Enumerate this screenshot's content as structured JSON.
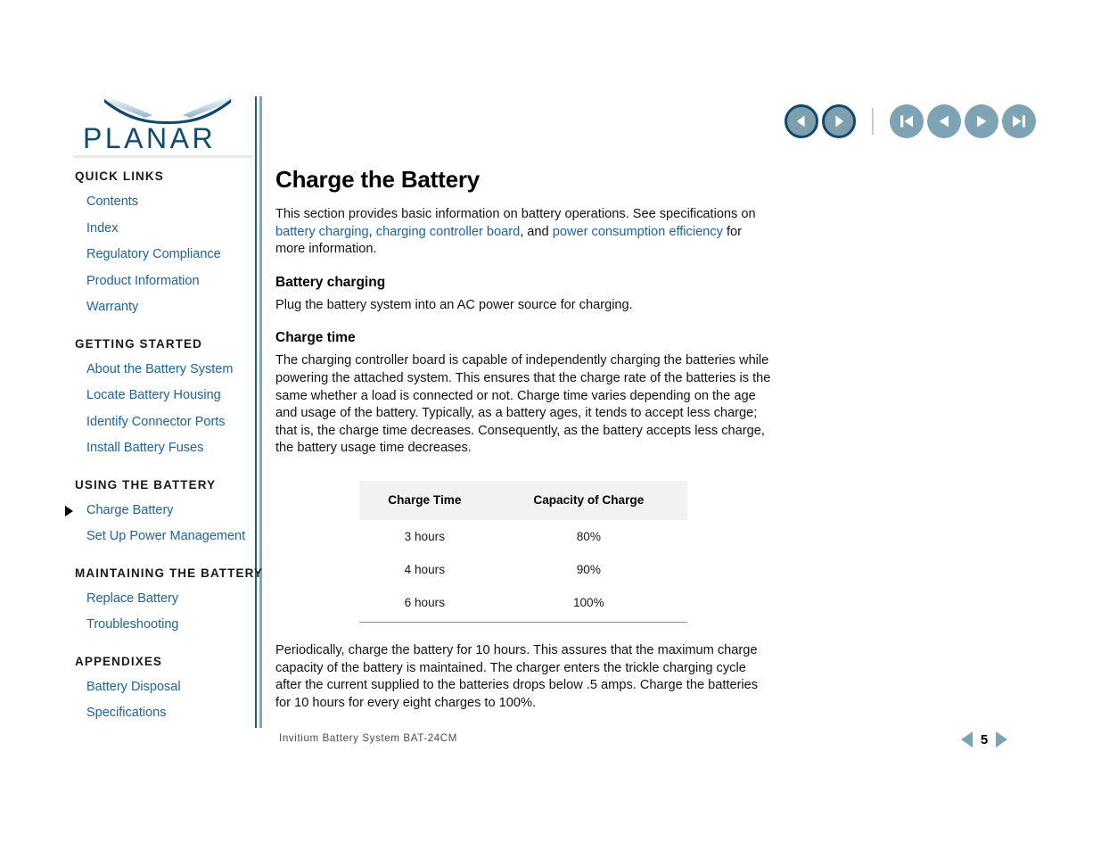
{
  "brand": {
    "name": "PLANAR",
    "logo_color": "#114a6b"
  },
  "topnav": {
    "back_label": "Back",
    "forward_label": "Forward",
    "first_label": "First Page",
    "prev_label": "Previous Page",
    "next_label": "Next Page",
    "last_label": "Last Page"
  },
  "sidebar": {
    "sections": [
      {
        "heading": "QUICK LINKS",
        "items": [
          {
            "label": "Contents",
            "active": false
          },
          {
            "label": "Index",
            "active": false
          },
          {
            "label": "Regulatory Compliance",
            "active": false
          },
          {
            "label": "Product Information",
            "active": false
          },
          {
            "label": "Warranty",
            "active": false
          }
        ]
      },
      {
        "heading": "GETTING STARTED",
        "items": [
          {
            "label": "About the Battery System",
            "active": false
          },
          {
            "label": "Locate Battery Housing",
            "active": false
          },
          {
            "label": "Identify Connector Ports",
            "active": false
          },
          {
            "label": "Install Battery Fuses",
            "active": false
          }
        ]
      },
      {
        "heading": "USING THE BATTERY",
        "items": [
          {
            "label": "Charge Battery",
            "active": true
          },
          {
            "label": "Set Up Power Management",
            "active": false
          }
        ]
      },
      {
        "heading": "MAINTAINING THE BATTERY",
        "items": [
          {
            "label": "Replace Battery",
            "active": false
          },
          {
            "label": "Troubleshooting",
            "active": false
          }
        ]
      },
      {
        "heading": "APPENDIXES",
        "items": [
          {
            "label": "Battery Disposal",
            "active": false
          },
          {
            "label": "Specifications",
            "active": false
          }
        ]
      }
    ]
  },
  "main": {
    "title": "Charge the Battery",
    "intro": {
      "part1": "This section provides basic information on battery operations. See specifications on ",
      "link1": "battery charging",
      "part2": ", ",
      "link2": "charging controller board",
      "part3": ", and ",
      "link3": "power consumption efficiency",
      "part4": " for more information."
    },
    "battery_charging": {
      "heading": "Battery charging",
      "body": "Plug the battery system into an AC power source for charging."
    },
    "charge_time": {
      "heading": "Charge time",
      "body": "The charging controller board is capable of independently charging the batteries while powering the attached system. This ensures that the charge rate of the batteries is the same whether a load is connected or not. Charge time varies depending on the age and usage of the battery. Typically, as a battery ages, it tends to accept less charge; that is, the charge time decreases. Consequently, as the battery accepts less charge, the battery usage time decreases."
    },
    "table": {
      "columns": [
        "Charge Time",
        "Capacity of Charge"
      ],
      "rows": [
        [
          "3 hours",
          "80%"
        ],
        [
          "4 hours",
          "90%"
        ],
        [
          "6 hours",
          "100%"
        ]
      ]
    },
    "closing": "Periodically, charge the battery for 10 hours. This assures that the maximum charge capacity of the battery is maintained. The charger enters the trickle charging cycle after the current supplied to the batteries drops below .5 amps. Charge the batteries for 10 hours for every eight charges to 100%."
  },
  "footer": {
    "document_title": "Invitium Battery System BAT-24CM",
    "page_number": "5"
  },
  "colors": {
    "link": "#1f6399",
    "logo": "#114a6b",
    "nav_button": "#7da3b5",
    "nav_ring": "#10496b",
    "table_header_bg": "#f2f2f2"
  }
}
